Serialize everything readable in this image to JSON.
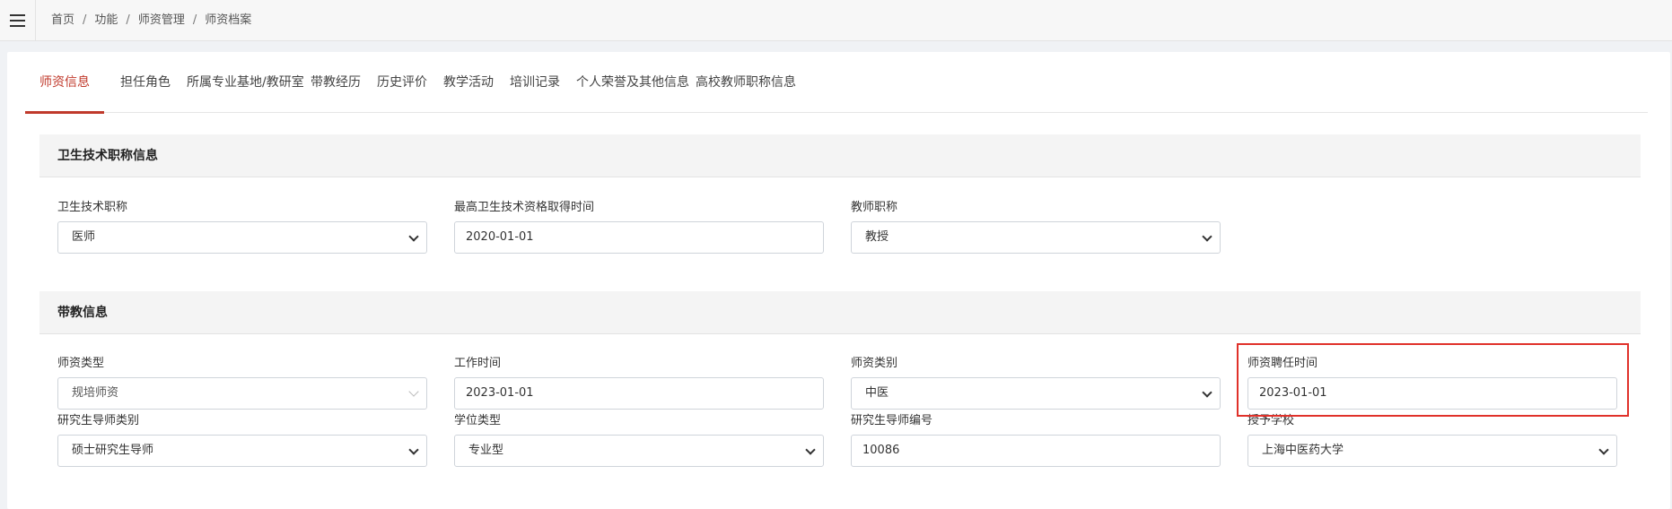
{
  "breadcrumb": [
    "首页",
    "功能",
    "师资管理",
    "师资档案"
  ],
  "tabs": [
    {
      "label": "师资信息",
      "active": true
    },
    {
      "label": "担任角色"
    },
    {
      "label": "所属专业基地/教研室"
    },
    {
      "label": "带教经历"
    },
    {
      "label": "历史评价"
    },
    {
      "label": "教学活动"
    },
    {
      "label": "培训记录"
    },
    {
      "label": "个人荣誉及其他信息"
    },
    {
      "label": "高校教师职称信息"
    }
  ],
  "section_health": {
    "title": "卫生技术职称信息",
    "fields": [
      {
        "label": "卫生技术职称",
        "value": "医师"
      },
      {
        "label": "最高卫生技术资格取得时间",
        "value": "2020-01-01"
      },
      {
        "label": "教师职称",
        "value": "教授"
      }
    ]
  },
  "section_teaching": {
    "title": "带教信息",
    "fields": [
      {
        "label": "师资类型",
        "value": "规培师资"
      },
      {
        "label": "工作时间",
        "value": "2023-01-01"
      },
      {
        "label": "师资类别",
        "value": "中医"
      },
      {
        "label": "师资聘任时间",
        "value": "2023-01-01"
      },
      {
        "label": "研究生导师类别",
        "value": "硕士研究生导师"
      },
      {
        "label": "学位类型",
        "value": "专业型"
      },
      {
        "label": "研究生导师编号",
        "value": "10086"
      },
      {
        "label": "授予学校",
        "value": "上海中医药大学"
      }
    ]
  },
  "colors": {
    "accent": "#c0392b",
    "highlight": "#e0312a"
  },
  "icons": {
    "menu": "hamburger-menu-icon",
    "dropdown": "chevron-down-icon"
  }
}
